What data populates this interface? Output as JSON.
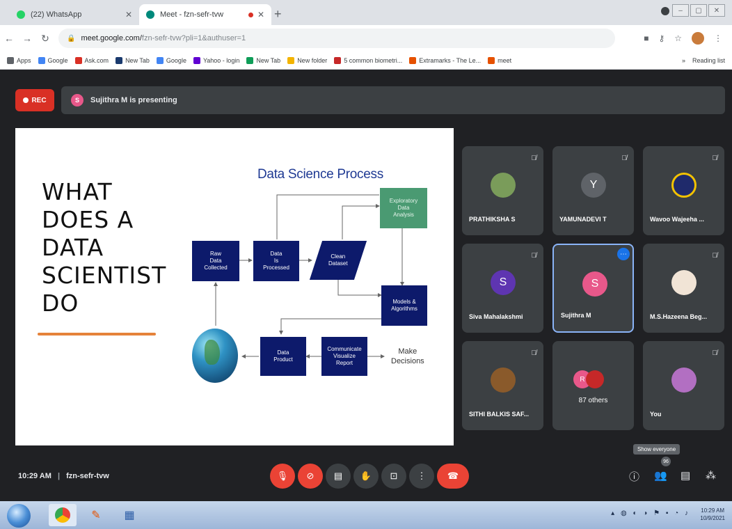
{
  "tabs": [
    {
      "title": "(22) WhatsApp",
      "active": false,
      "favicon_color": "#25d366"
    },
    {
      "title": "Meet - fzn-sefr-tvw",
      "active": true,
      "favicon_color": "#00897b"
    }
  ],
  "toolbar": {
    "url_host": "meet.google.com/",
    "url_path": "fzn-sefr-tvw?pli=1&authuser=1"
  },
  "bookmarks": [
    {
      "label": "Apps",
      "color": "#5f6368"
    },
    {
      "label": "Google",
      "color": "#4285f4"
    },
    {
      "label": "Ask.com",
      "color": "#d93025"
    },
    {
      "label": "New Tab",
      "color": "#1a3a6e"
    },
    {
      "label": "Google",
      "color": "#4285f4"
    },
    {
      "label": "Yahoo - login",
      "color": "#6001d2"
    },
    {
      "label": "New Tab",
      "color": "#0f9d58"
    },
    {
      "label": "New folder",
      "color": "#f4b400"
    },
    {
      "label": "5 common biometri...",
      "color": "#c62828"
    },
    {
      "label": "Extramarks - The Le...",
      "color": "#e65100"
    },
    {
      "label": "meet",
      "color": "#e65100"
    }
  ],
  "reading_list": "Reading list",
  "meet": {
    "rec_label": "REC",
    "presenting_text": "Sujithra M is presenting",
    "presenter_initial": "S",
    "meeting_time": "10:29 AM",
    "meeting_code": "fzn-sefr-tvw",
    "tooltip": "Show everyone",
    "participant_count": "96"
  },
  "slide": {
    "heading": "WHAT\nDOES A\nDATA\nSCIENTIST\nDO",
    "process_title": "Data Science Process",
    "boxes": {
      "raw": "Raw\nData\nCollected",
      "processed": "Data\nIs\nProcessed",
      "clean": "Clean\nDataset",
      "eda": "Exploratory\nData\nAnalysis",
      "models": "Models &\nAlgorithms",
      "product": "Data\nProduct",
      "communicate": "Communicate\nVisualize\nReport"
    },
    "make_decisions": "Make\nDecisions"
  },
  "participants": [
    {
      "name": "PRATHIKSHA S",
      "initial": "",
      "color": "#7a9c5a",
      "muted": true
    },
    {
      "name": "YAMUNADEVI T",
      "initial": "Y",
      "color": "#5f6368",
      "muted": true
    },
    {
      "name": "Wavoo Wajeeha ...",
      "initial": "",
      "color": "#1f2a6b",
      "muted": true
    },
    {
      "name": "Siva Mahalakshmi",
      "initial": "S",
      "color": "#5e35b1",
      "muted": true
    },
    {
      "name": "Sujithra M",
      "initial": "S",
      "color": "#e8588a",
      "muted": false,
      "active": true
    },
    {
      "name": "M.S.Hazeena Beg...",
      "initial": "",
      "color": "#f1e4d6",
      "muted": true
    },
    {
      "name": "SITHI BALKIS SAF...",
      "initial": "",
      "color": "#8a5a2b",
      "muted": true
    },
    {
      "name": "87 others",
      "initial": "",
      "color": "#3c4043",
      "muted": false
    },
    {
      "name": "You",
      "initial": "",
      "color": "#b26fc2",
      "muted": true
    }
  ],
  "others_initials": [
    "R",
    ""
  ],
  "taskbar": {
    "clock_time": "10:29 AM",
    "clock_date": "10/9/2021"
  }
}
